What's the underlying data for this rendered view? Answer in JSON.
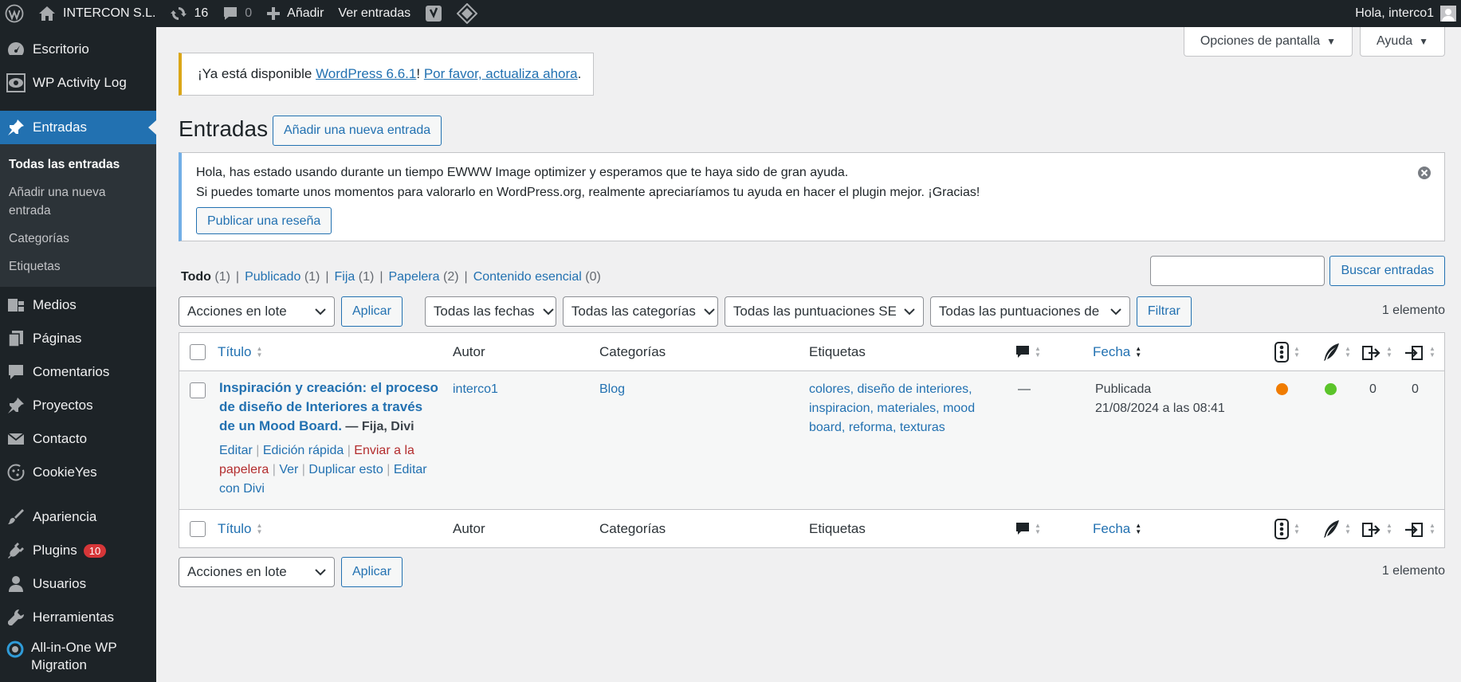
{
  "adminbar": {
    "site_name": "INTERCON S.L.",
    "updates_count": "16",
    "comments_count": "0",
    "new_label": "Añadir",
    "view_posts_label": "Ver entradas",
    "greeting": "Hola, interco1"
  },
  "sidebar": {
    "items": [
      {
        "label": "Escritorio",
        "icon": "dashboard-icon"
      },
      {
        "label": "WP Activity Log",
        "icon": "eye-icon"
      },
      {
        "label": "Entradas",
        "icon": "pin-icon"
      },
      {
        "label": "Medios",
        "icon": "media-icon"
      },
      {
        "label": "Páginas",
        "icon": "pages-icon"
      },
      {
        "label": "Comentarios",
        "icon": "comment-icon"
      },
      {
        "label": "Proyectos",
        "icon": "pin-icon"
      },
      {
        "label": "Contacto",
        "icon": "mail-icon"
      },
      {
        "label": "CookieYes",
        "icon": "cookie-icon"
      },
      {
        "label": "Apariencia",
        "icon": "brush-icon"
      },
      {
        "label": "Plugins",
        "icon": "plugin-icon",
        "badge": "10"
      },
      {
        "label": "Usuarios",
        "icon": "user-icon"
      },
      {
        "label": "Herramientas",
        "icon": "wrench-icon"
      },
      {
        "label": "All-in-One WP Migration",
        "icon": "migration-icon"
      }
    ],
    "submenu": [
      "Todas las entradas",
      "Añadir una nueva entrada",
      "Categorías",
      "Etiquetas"
    ]
  },
  "screen_options": {
    "options_label": "Opciones de pantalla",
    "help_label": "Ayuda"
  },
  "update_nag": {
    "prefix": "¡Ya está disponible ",
    "version_link": "WordPress 6.6.1",
    "middle": "! ",
    "update_link": "Por favor, actualiza ahora",
    "suffix": "."
  },
  "page": {
    "title": "Entradas",
    "add_new_label": "Añadir una nueva entrada"
  },
  "notice": {
    "line1": "Hola, has estado usando durante un tiempo EWWW Image optimizer y esperamos que te haya sido de gran ayuda.",
    "line2": "Si puedes tomarte unos momentos para valorarlo en WordPress.org, realmente apreciaríamos tu ayuda en hacer el plugin mejor. ¡Gracias!",
    "button": "Publicar una reseña"
  },
  "views": [
    {
      "label": "Todo",
      "count": "(1)"
    },
    {
      "label": "Publicado",
      "count": "(1)"
    },
    {
      "label": "Fija",
      "count": "(1)"
    },
    {
      "label": "Papelera",
      "count": "(2)"
    },
    {
      "label": "Contenido esencial",
      "count": "(0)"
    }
  ],
  "search": {
    "button": "Buscar entradas",
    "value": ""
  },
  "tablenav": {
    "bulk_actions": "Acciones en lote",
    "apply": "Aplicar",
    "dates": "Todas las fechas",
    "categories": "Todas las categorías",
    "seo_scores": "Todas las puntuaciones SEO",
    "readability_scores": "Todas las puntuaciones de legibilidad",
    "filter": "Filtrar",
    "count": "1 elemento"
  },
  "table": {
    "headers": {
      "title": "Título",
      "author": "Autor",
      "categories": "Categorías",
      "tags": "Etiquetas",
      "date": "Fecha"
    },
    "rows": [
      {
        "title_line1": "Inspiración y creación: el proceso",
        "title_line2": "de diseño de Interiores a través",
        "title_line3": "de un Mood Board.",
        "state": " — Fija, Divi",
        "actions": {
          "edit": "Editar",
          "quick_edit": "Edición rápida",
          "trash_1": "Enviar a la",
          "trash_2": "papelera",
          "view": "Ver",
          "duplicate": "Duplicar esto",
          "divi_1": "Editar",
          "divi_2": "con Divi"
        },
        "author": "interco1",
        "category": "Blog",
        "tags_line1": "colores, diseño de interiores,",
        "tags_line2": "inspiracion, materiales, mood",
        "tags_line3": "board, reforma, texturas",
        "comments": "—",
        "date_status": "Publicada",
        "date_value": "21/08/2024 a las 08:41",
        "seo_color": "#f07c00",
        "readability_color": "#5bc42a",
        "links_out": "0",
        "links_in": "0"
      }
    ]
  }
}
